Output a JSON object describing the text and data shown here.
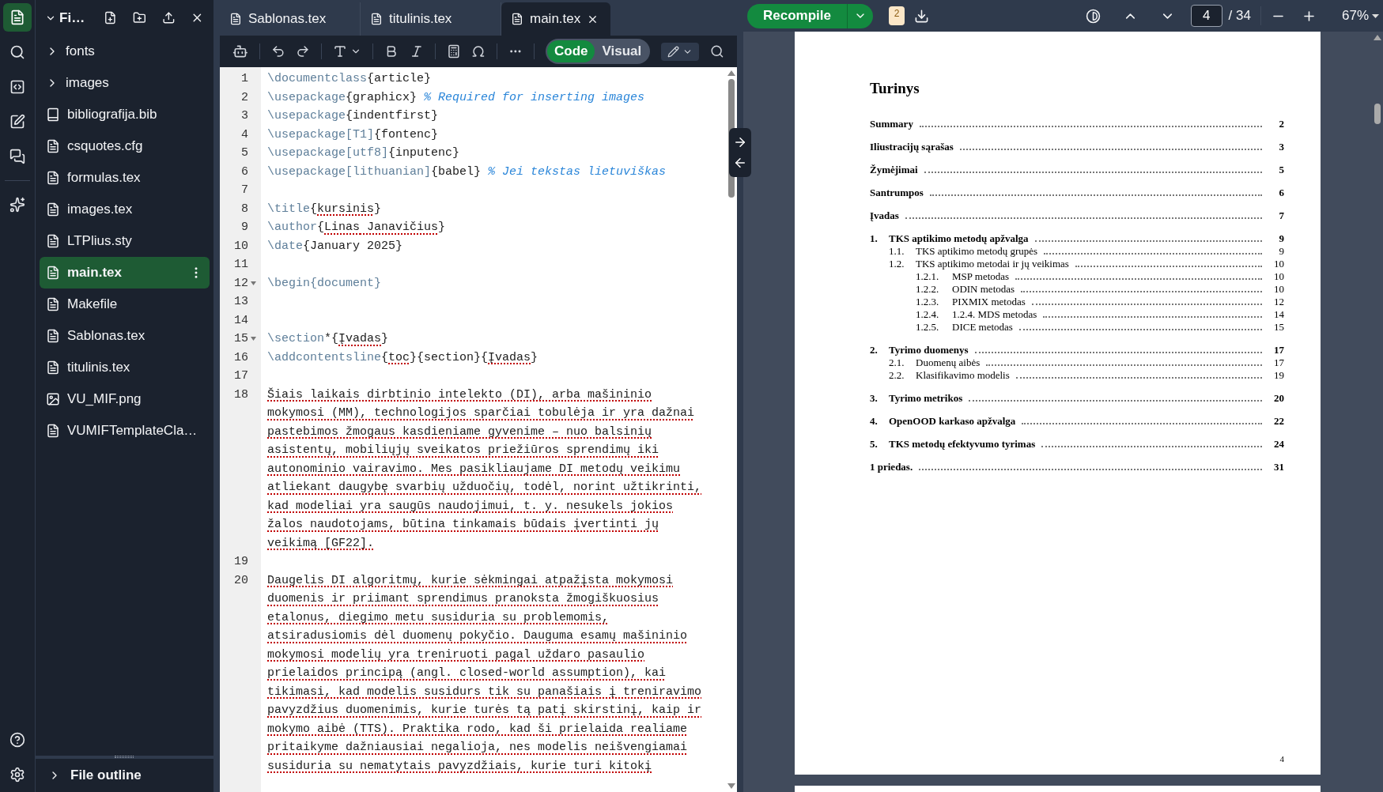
{
  "rail": [
    {
      "kind": "files",
      "selected": true
    },
    {
      "kind": "search",
      "selected": false
    },
    {
      "kind": "code",
      "selected": false
    },
    {
      "kind": "review",
      "selected": false
    },
    {
      "kind": "chat",
      "selected": false
    },
    {
      "kind": "ai",
      "selected": false
    },
    {
      "kind": "help",
      "selected": false
    },
    {
      "kind": "settings",
      "selected": false
    }
  ],
  "file_panel": {
    "title": "Fi…",
    "tree": [
      {
        "name": "fonts",
        "kind": "folder",
        "selected": false
      },
      {
        "name": "images",
        "kind": "folder",
        "selected": false
      },
      {
        "name": "bibliografija.bib",
        "kind": "bib",
        "selected": false
      },
      {
        "name": "csquotes.cfg",
        "kind": "file",
        "selected": false
      },
      {
        "name": "formulas.tex",
        "kind": "file",
        "selected": false
      },
      {
        "name": "images.tex",
        "kind": "file",
        "selected": false
      },
      {
        "name": "LTPlius.sty",
        "kind": "file",
        "selected": false
      },
      {
        "name": "main.tex",
        "kind": "file",
        "selected": true
      },
      {
        "name": "Makefile",
        "kind": "file",
        "selected": false
      },
      {
        "name": "Sablonas.tex",
        "kind": "file",
        "selected": false
      },
      {
        "name": "titulinis.tex",
        "kind": "file",
        "selected": false
      },
      {
        "name": "VU_MIF.png",
        "kind": "image",
        "selected": false
      },
      {
        "name": "VUMIFTemplateCla…",
        "kind": "file",
        "selected": false
      }
    ],
    "outline": {
      "label": "File outline"
    }
  },
  "editor": {
    "tabs": [
      {
        "label": "Sablonas.tex",
        "selected": false
      },
      {
        "label": "titulinis.tex",
        "selected": false
      },
      {
        "label": "main.tex",
        "selected": true
      }
    ],
    "mode_toggle": [
      {
        "label": "Code",
        "selected": true
      },
      {
        "label": "Visual",
        "selected": false
      }
    ],
    "lines": [
      {
        "number": "1",
        "kind": "code",
        "foldable": false,
        "segments": [
          {
            "text": "\\documentclass",
            "kind": "cmd",
            "misspelled": false
          },
          {
            "text": "{article}",
            "kind": "text",
            "misspelled": false
          }
        ]
      },
      {
        "number": "2",
        "kind": "code",
        "foldable": false,
        "segments": [
          {
            "text": "\\usepackage",
            "kind": "cmd",
            "misspelled": false
          },
          {
            "text": "{graphicx} ",
            "kind": "text",
            "misspelled": false
          },
          {
            "text": "% Required for inserting images",
            "kind": "comment",
            "misspelled": false
          }
        ]
      },
      {
        "number": "3",
        "kind": "code",
        "foldable": false,
        "segments": [
          {
            "text": "\\usepackage",
            "kind": "cmd",
            "misspelled": false
          },
          {
            "text": "{indentfirst}",
            "kind": "text",
            "misspelled": false
          }
        ]
      },
      {
        "number": "4",
        "kind": "code",
        "foldable": false,
        "segments": [
          {
            "text": "\\usepackage",
            "kind": "cmd",
            "misspelled": false
          },
          {
            "text": "[T1]",
            "kind": "arg",
            "misspelled": false
          },
          {
            "text": "{fontenc}",
            "kind": "text",
            "misspelled": false
          }
        ]
      },
      {
        "number": "5",
        "kind": "code",
        "foldable": false,
        "segments": [
          {
            "text": "\\usepackage",
            "kind": "cmd",
            "misspelled": false
          },
          {
            "text": "[utf8]",
            "kind": "arg",
            "misspelled": false
          },
          {
            "text": "{inputenc}",
            "kind": "text",
            "misspelled": false
          }
        ]
      },
      {
        "number": "6",
        "kind": "code",
        "foldable": false,
        "segments": [
          {
            "text": "\\usepackage",
            "kind": "cmd",
            "misspelled": false
          },
          {
            "text": "[lithuanian]",
            "kind": "arg",
            "misspelled": false
          },
          {
            "text": "{babel} ",
            "kind": "text",
            "misspelled": false
          },
          {
            "text": "% Jei tekstas lietuviškas",
            "kind": "comment",
            "misspelled": false
          }
        ]
      },
      {
        "number": "7",
        "kind": "code",
        "foldable": false
      },
      {
        "number": "8",
        "kind": "code",
        "foldable": false,
        "segments": [
          {
            "text": "\\title",
            "kind": "cmd",
            "misspelled": false
          },
          {
            "text": "{",
            "kind": "text",
            "misspelled": false
          },
          {
            "text": "kursinis",
            "kind": "text",
            "misspelled": true
          },
          {
            "text": "}",
            "kind": "text",
            "misspelled": false
          }
        ]
      },
      {
        "number": "9",
        "kind": "code",
        "foldable": false,
        "segments": [
          {
            "text": "\\author",
            "kind": "cmd",
            "misspelled": false
          },
          {
            "text": "{",
            "kind": "text",
            "misspelled": false
          },
          {
            "text": "Linas",
            "kind": "text",
            "misspelled": true
          },
          {
            "text": " Janavičius",
            "kind": "text",
            "misspelled": true
          },
          {
            "text": "}",
            "kind": "text",
            "misspelled": false
          }
        ]
      },
      {
        "number": "10",
        "kind": "code",
        "foldable": false,
        "segments": [
          {
            "text": "\\date",
            "kind": "cmd",
            "misspelled": false
          },
          {
            "text": "{January 2025}",
            "kind": "text",
            "misspelled": false
          }
        ]
      },
      {
        "number": "11",
        "kind": "code",
        "foldable": false
      },
      {
        "number": "12",
        "kind": "code",
        "foldable": true,
        "segments": [
          {
            "text": "\\begin",
            "kind": "cmd",
            "misspelled": false
          },
          {
            "text": "{document}",
            "kind": "arg",
            "misspelled": false
          }
        ]
      },
      {
        "number": "13",
        "kind": "code",
        "foldable": false
      },
      {
        "number": "14",
        "kind": "code",
        "foldable": false
      },
      {
        "number": "15",
        "kind": "code",
        "foldable": true,
        "segments": [
          {
            "text": "\\section",
            "kind": "cmd",
            "misspelled": false
          },
          {
            "text": "*{",
            "kind": "text",
            "misspelled": false
          },
          {
            "text": "Įvadas",
            "kind": "text",
            "misspelled": true
          },
          {
            "text": "}",
            "kind": "text",
            "misspelled": false
          }
        ]
      },
      {
        "number": "16",
        "kind": "code",
        "foldable": false,
        "segments": [
          {
            "text": "\\addcontentsline",
            "kind": "cmd",
            "misspelled": false
          },
          {
            "text": "{",
            "kind": "text",
            "misspelled": false
          },
          {
            "text": "toc",
            "kind": "text",
            "misspelled": true
          },
          {
            "text": "}{section}{",
            "kind": "text",
            "misspelled": false
          },
          {
            "text": "Įvadas",
            "kind": "text",
            "misspelled": true
          },
          {
            "text": "}",
            "kind": "text",
            "misspelled": false
          }
        ]
      },
      {
        "number": "17",
        "kind": "code",
        "foldable": false
      },
      {
        "number": "18",
        "kind": "paragraph",
        "foldable": false,
        "spell_errors": true,
        "rows": [
          "Šiais laikais dirbtinio intelekto (DI), arba mašininio",
          "mokymosi (MM), technologijos sparčiai tobulėja ir yra dažnai",
          "pastebimos žmogaus kasdieniame gyvenime – nuo balsinių",
          "asistentų, mobiliųjų sveikatos priežiūros sprendimų iki",
          "autonominio vairavimo. Mes pasikliaujame DI metodų veikimu",
          "atliekant daugybę svarbių užduočių, todėl, norint užtikrinti,",
          "kad modeliai yra saugūs naudojimui, t. y. nesukels jokios",
          "žalos naudotojams, būtina tinkamais būdais įvertinti jų",
          "veikimą [GF22]."
        ]
      },
      {
        "number": "19",
        "kind": "code",
        "foldable": false
      },
      {
        "number": "20",
        "kind": "paragraph",
        "foldable": false,
        "spell_errors": true,
        "rows": [
          "Daugelis DI algoritmų, kurie sėkmingai atpažįsta mokymosi",
          "duomenis ir priimant sprendimus pranoksta žmogiškuosius",
          "etalonus, diegimo metu susiduria su problemomis,",
          "atsiradusiomis dėl duomenų pokyčio. Dauguma esamų mašininio",
          "mokymosi modelių yra treniruoti pagal uždaro pasaulio",
          "prielaidos principą (angl. closed-world assumption), kai",
          "tikimasi, kad modelis susidurs tik su panašiais į treniravimo",
          "pavyzdžius duomenimis, kurie turės tą patį skirstinį, kaip ir",
          "mokymo aibė (TTS). Praktika rodo, kad ši prielaida realiame",
          "pritaikyme dažniausiai negalioja, nes modelis neišvengiamai",
          "susiduria su nematytais pavyzdžiais, kurie turi kitokį"
        ]
      }
    ]
  },
  "pdf": {
    "recompile": "Recompile",
    "log_count": "2",
    "page_input": "4",
    "page_total": "/ 34",
    "zoom": "67%",
    "page": {
      "title": "Turinys",
      "page_number": "4",
      "toc": [
        {
          "title": "Summary",
          "page": "2"
        },
        {
          "title": "Iliustracijų sąrašas",
          "page": "3"
        },
        {
          "title": "Žymėjimai",
          "page": "5"
        },
        {
          "title": "Santrumpos",
          "page": "6"
        },
        {
          "title": "Įvadas",
          "page": "7"
        },
        {
          "number": "1.",
          "title": "TKS aptikimo metodų apžvalga",
          "page": "9",
          "children": [
            {
              "number": "1.1.",
              "title": "TKS aptikimo metodų grupės",
              "page": "9"
            },
            {
              "number": "1.2.",
              "title": "TKS aptikimo metodai ir jų veikimas",
              "page": "10",
              "children": [
                {
                  "number": "1.2.1.",
                  "title": "MSP metodas",
                  "page": "10"
                },
                {
                  "number": "1.2.2.",
                  "title": "ODIN metodas",
                  "page": "10"
                },
                {
                  "number": "1.2.3.",
                  "title": "PIXMIX metodas",
                  "page": "12"
                },
                {
                  "number": "1.2.4.",
                  "title": "1.2.4. MDS metodas",
                  "page": "14"
                },
                {
                  "number": "1.2.5.",
                  "title": "DICE metodas",
                  "page": "15"
                }
              ]
            }
          ]
        },
        {
          "number": "2.",
          "title": "Tyrimo duomenys",
          "page": "17",
          "children": [
            {
              "number": "2.1.",
              "title": "Duomenų aibės",
              "page": "17"
            },
            {
              "number": "2.2.",
              "title": "Klasifikavimo modelis",
              "page": "19"
            }
          ]
        },
        {
          "number": "3.",
          "title": "Tyrimo metrikos",
          "page": "20"
        },
        {
          "number": "4.",
          "title": "OpenOOD karkaso apžvalga",
          "page": "22"
        },
        {
          "number": "5.",
          "title": "TKS metodų efektyvumo tyrimas",
          "page": "24"
        },
        {
          "title": "1 priedas.",
          "page": "31"
        }
      ]
    }
  }
}
